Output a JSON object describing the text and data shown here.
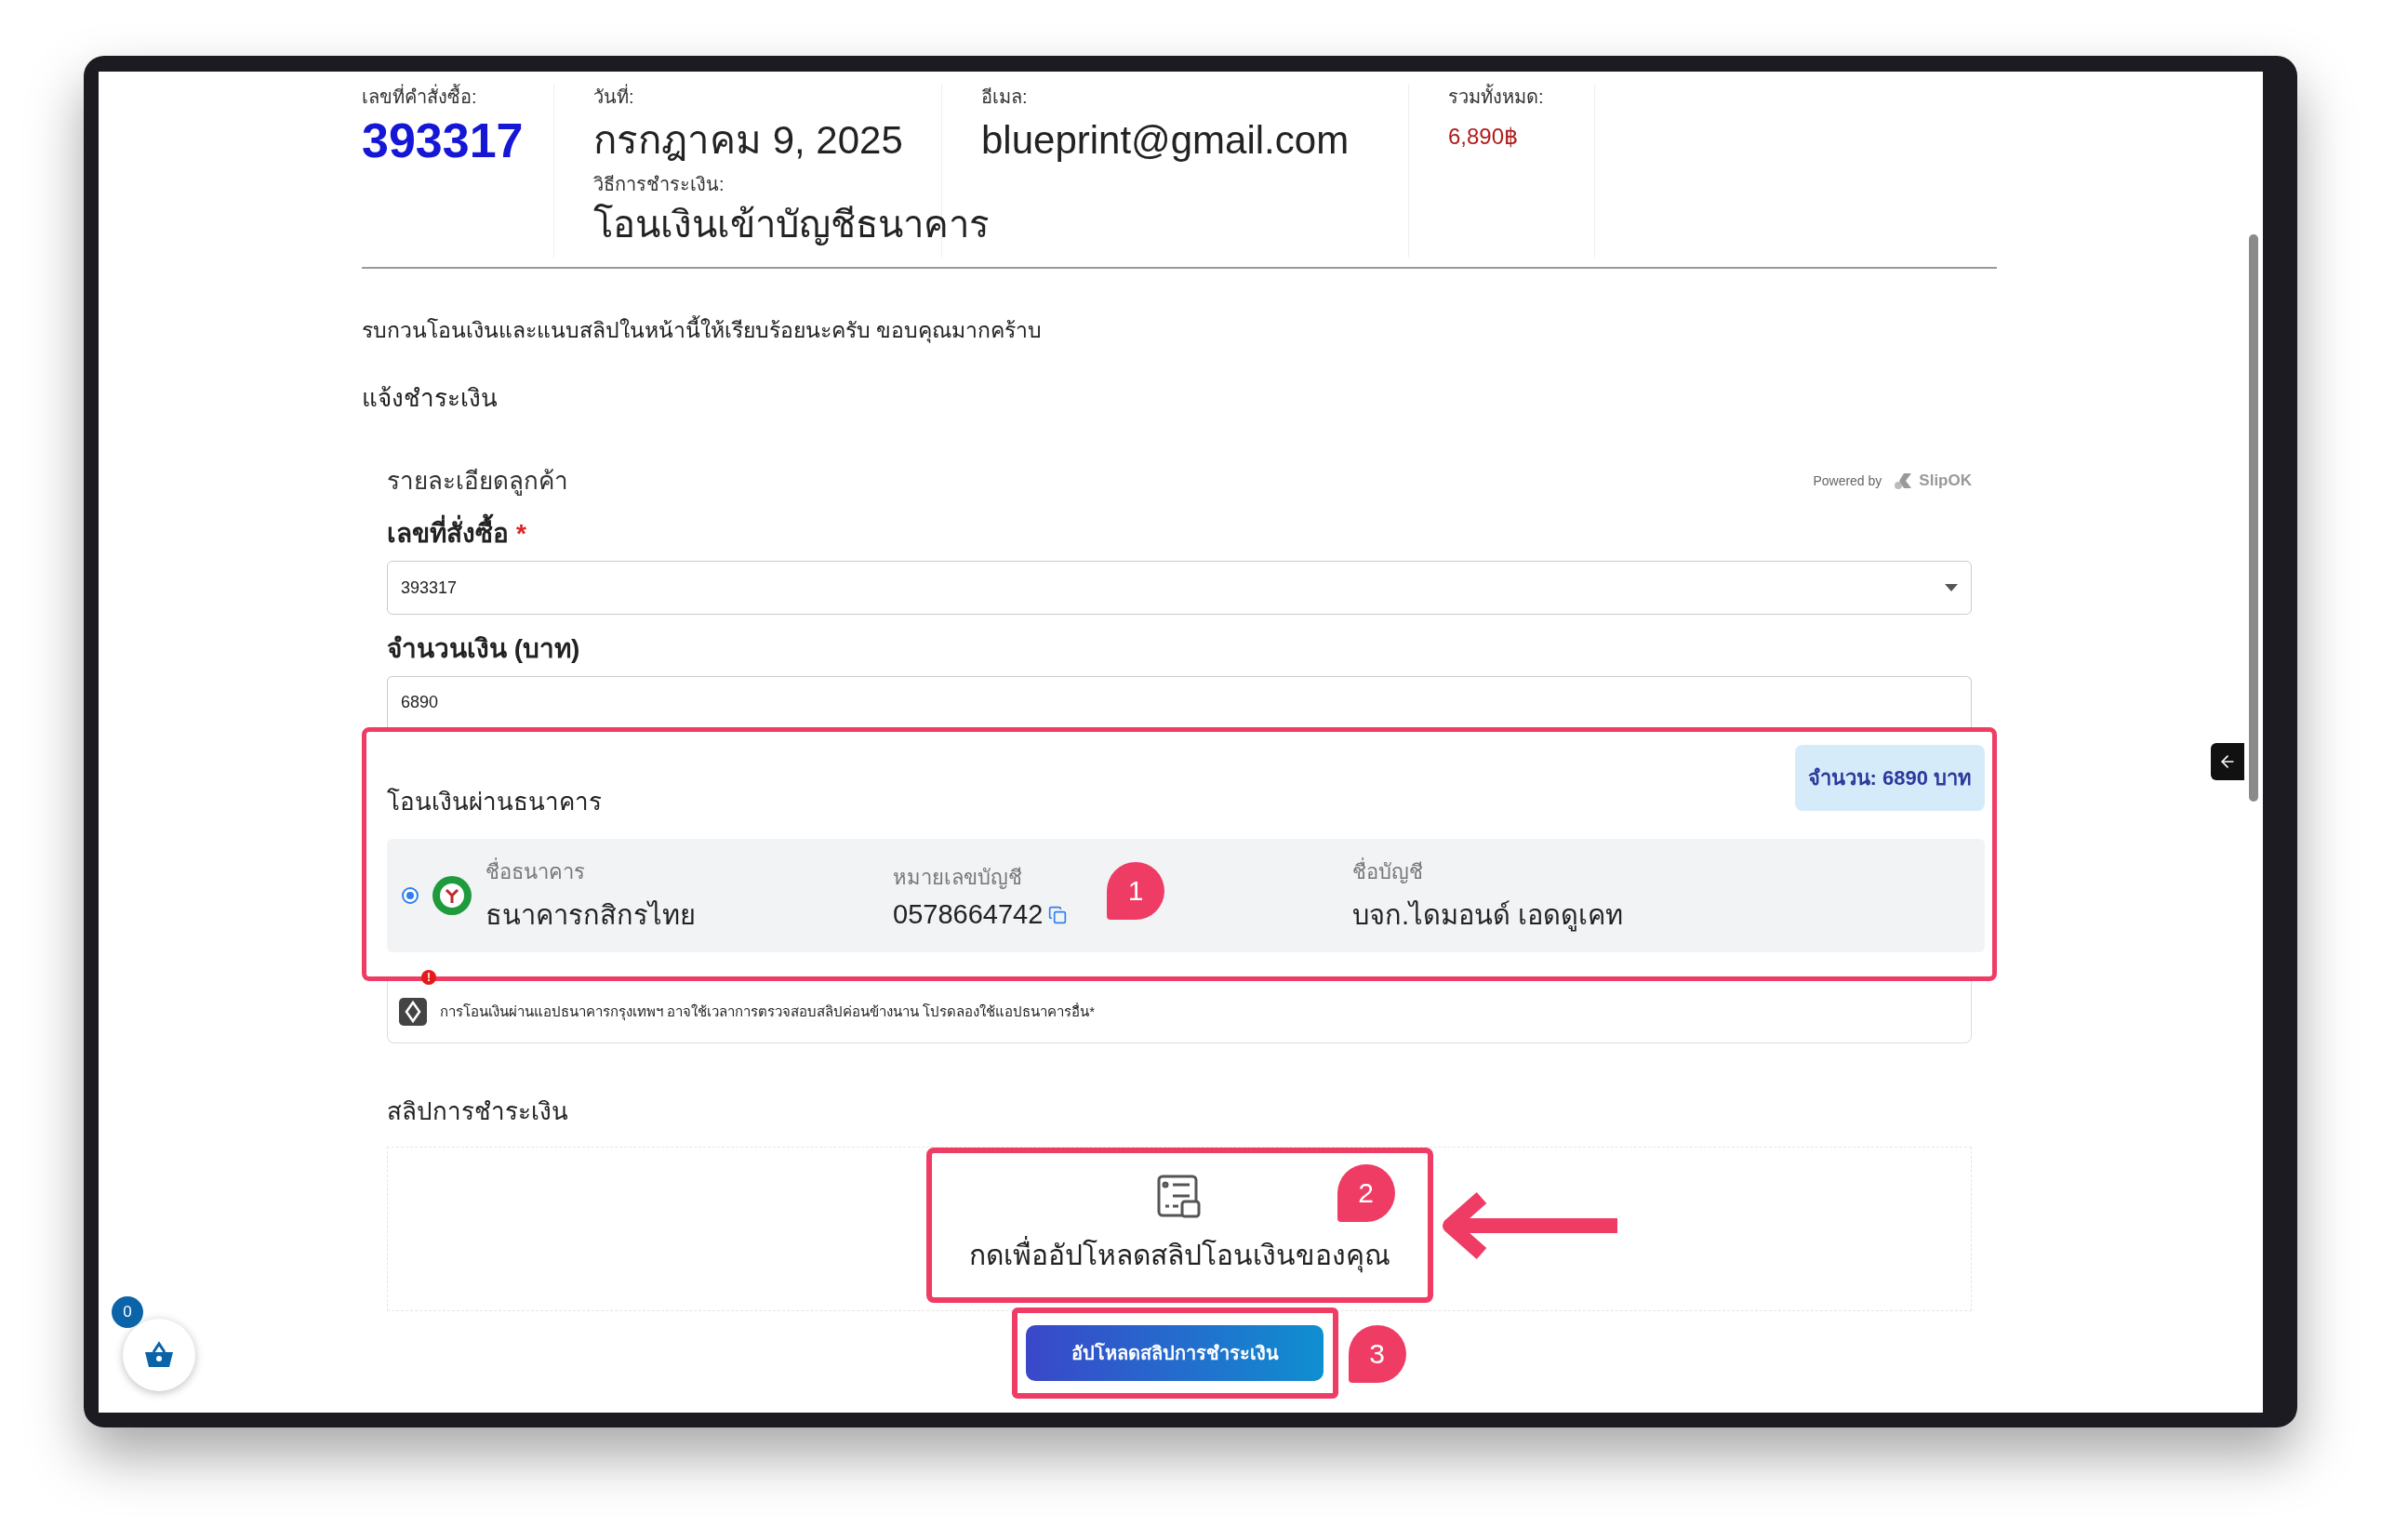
{
  "header": {
    "fields": [
      {
        "kind": "order",
        "label": "เลขที่คำสั่งซื้อ:",
        "value": "393317"
      },
      {
        "kind": "date",
        "label": "วันที่:",
        "value": "กรกฎาคม 9, 2025",
        "sub_label": "วิธีการชำระเงิน:",
        "sub_value": "โอนเงินเข้าบัญชีธนาคาร"
      },
      {
        "kind": "plain",
        "label": "อีเมล:",
        "value": "blueprint@gmail.com"
      },
      {
        "kind": "total",
        "label": "รวมทั้งหมด:",
        "value": "6,890฿"
      }
    ]
  },
  "message": "รบกวนโอนเงินและแนบสลิปในหน้านี้ให้เรียบร้อยนะครับ ขอบคุณมากคร้าบ",
  "section_title": "แจ้งชำระเงิน",
  "form": {
    "title": "รายละเอียดลูกค้า",
    "powered_by": "Powered by",
    "brand": "SlipOK",
    "order_field": {
      "label": "เลขที่สั่งซื้อ",
      "required_mark": "*",
      "value": "393317"
    },
    "amount_field": {
      "label": "จำนวนเงิน (บาท)",
      "value": "6890"
    },
    "bank_section": {
      "title": "โอนเงินผ่านธนาคาร",
      "amount_badge": "จำนวน: 6890 บาท",
      "accounts": [
        {
          "selected": true,
          "bank_label": "ชื่อธนาคาร",
          "bank": "ธนาคารกสิกรไทย",
          "number_label": "หมายเลขบัญชี",
          "number": "0578664742",
          "name_label": "ชื่อบัญชี",
          "name": "บจก.ไดมอนด์ เอดดูเคท"
        }
      ]
    },
    "notice": {
      "alert": "!",
      "text": "การโอนเงินผ่านแอปธนาคารกรุงเทพฯ อาจใช้เวลาการตรวจสอบสลิปค่อนข้างนาน โปรดลองใช้แอปธนาคารอื่น*"
    },
    "slip": {
      "label": "สลิปการชำระเงิน",
      "dropzone_text": "กดเพื่ออัปโหลดสลิปโอนเงินของคุณ",
      "button": "อัปโหลดสลิปการชำระเงิน"
    }
  },
  "annotations": [
    "1",
    "2",
    "3"
  ],
  "cart": {
    "count": "0"
  }
}
